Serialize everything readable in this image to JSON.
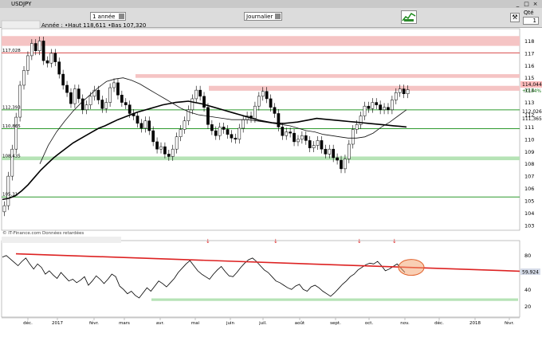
{
  "window": {
    "title": "USDJPY"
  },
  "toolbar": {
    "period": "1 année",
    "chart_type": "Journalier",
    "qty_label": "Qté",
    "qty_value": "1"
  },
  "header": {
    "legend": "Année : •Haut 118,611 •Bas 107,320"
  },
  "source_note": "© IT-Finance.com Données retardées",
  "colors": {
    "candle": "#000000",
    "ma_long": "#000000",
    "resistance_zone": "#f5c4c4",
    "resistance_line": "#d94c4c",
    "support_zone": "#b6e3b6",
    "support_line": "#2e9a2e",
    "trendline": "#dd2222",
    "highlight": "#f3a06a",
    "price_badge": "#ffbcbc",
    "rsi_badge": "#d5dbe8"
  },
  "chart_data": [
    {
      "type": "candlestick",
      "title": "USDJPY",
      "y_ticks": [
        "118",
        "117",
        "116",
        "115",
        "114",
        "113",
        "112",
        "111",
        "110",
        "109",
        "108",
        "107",
        "106",
        "105",
        "104",
        "103"
      ],
      "x_ticks": [
        "déc.",
        "2017",
        "févr.",
        "mars",
        "avr.",
        "mai",
        "juin",
        "juil.",
        "août",
        "sept.",
        "oct.",
        "nov.",
        "déc.",
        "2018",
        "févr."
      ],
      "ylim": [
        102.6,
        119.0
      ],
      "year_high": 118.611,
      "year_low": 107.32,
      "last_price": "114,044",
      "last_change": "+0,34%",
      "price_tags": [
        "117,028",
        "112,393",
        "110,865",
        "108,435",
        "105,31"
      ],
      "right_tags": [
        "114,044",
        "+0,34%",
        "112,026",
        "111,365"
      ],
      "resistance_zones": [
        [
          117.6,
          118.4
        ],
        [
          115.0,
          115.3
        ],
        [
          113.95,
          114.35
        ]
      ],
      "resistance_lines": [
        117.03
      ],
      "support_lines": [
        112.393,
        110.865,
        105.31
      ],
      "support_zones": [
        [
          108.3,
          108.6
        ]
      ],
      "closes": [
        104.6,
        107.0,
        109.2,
        111.8,
        114.4,
        115.6,
        116.8,
        117.8,
        117.2,
        118.0,
        116.4,
        116.2,
        117.0,
        116.3,
        115.3,
        114.4,
        113.8,
        112.9,
        114.1,
        113.3,
        112.4,
        112.8,
        113.5,
        114.0,
        113.2,
        112.5,
        113.0,
        114.2,
        114.6,
        113.6,
        113.0,
        112.8,
        112.1,
        111.9,
        111.3,
        110.9,
        111.5,
        110.7,
        109.8,
        109.2,
        109.4,
        108.8,
        108.6,
        109.2,
        110.2,
        110.8,
        111.5,
        112.4,
        113.3,
        114.0,
        113.5,
        112.6,
        111.2,
        110.7,
        110.3,
        111.0,
        110.8,
        110.4,
        110.1,
        110.0,
        110.9,
        111.6,
        111.9,
        111.7,
        112.7,
        113.5,
        113.9,
        113.3,
        112.6,
        112.1,
        111.0,
        110.3,
        110.6,
        110.5,
        109.8,
        110.0,
        110.3,
        109.9,
        109.3,
        109.5,
        109.9,
        109.2,
        108.8,
        109.2,
        108.5,
        108.3,
        107.6,
        108.4,
        109.6,
        110.8,
        111.2,
        111.9,
        112.7,
        112.5,
        113.0,
        112.8,
        112.4,
        112.6,
        112.4,
        113.2,
        113.8,
        114.1,
        113.7,
        114.04
      ],
      "series": [
        {
          "name": "",
          "values": [
            105.1,
            105.2,
            105.4,
            105.8,
            106.3,
            106.9,
            107.5,
            108.0,
            108.5,
            108.9,
            109.3,
            109.7,
            110.0,
            110.3,
            110.6,
            110.9,
            111.1,
            111.35,
            111.6,
            111.8,
            112.0,
            112.2,
            112.35,
            112.5,
            112.65,
            112.8,
            112.9,
            113.0,
            113.05,
            113.1,
            113.0,
            112.9,
            112.75,
            112.6,
            112.45,
            112.3,
            112.15,
            112.0,
            111.85,
            111.7,
            111.55,
            111.45,
            111.35,
            111.3,
            111.3,
            111.35,
            111.4,
            111.5,
            111.6,
            111.7,
            111.65,
            111.6,
            111.55,
            111.5,
            111.45,
            111.4,
            111.35,
            111.3,
            111.25,
            111.2,
            111.15,
            111.1,
            111.05,
            111.0
          ]
        },
        {
          "name": "",
          "values": [
            108.0,
            109.5,
            110.6,
            111.5,
            112.3,
            113.0,
            113.6,
            114.2,
            114.7,
            114.9,
            115.0,
            114.8,
            114.5,
            114.1,
            113.7,
            113.3,
            112.9,
            112.5,
            112.2,
            112.0,
            111.9,
            111.8,
            111.7,
            111.6,
            111.6,
            111.6,
            111.5,
            111.4,
            111.3,
            111.2,
            111.1,
            110.9,
            110.7,
            110.6,
            110.4,
            110.3,
            110.2,
            110.1,
            110.1,
            110.2,
            110.5,
            111.0,
            111.4,
            111.9,
            112.4
          ]
        }
      ]
    },
    {
      "type": "line",
      "title": "",
      "y_ticks": [
        "80",
        "60",
        "40",
        "20"
      ],
      "ylim": [
        15,
        90
      ],
      "last_value": "59,924",
      "support_level": 28,
      "markers": [
        "↓",
        "↓",
        "↓",
        "↓"
      ],
      "series": [
        {
          "name": "",
          "values": [
            78,
            80,
            76,
            72,
            68,
            73,
            77,
            70,
            64,
            70,
            66,
            58,
            62,
            57,
            53,
            60,
            55,
            50,
            52,
            48,
            51,
            55,
            45,
            50,
            56,
            52,
            47,
            52,
            58,
            55,
            44,
            40,
            35,
            38,
            33,
            30,
            36,
            42,
            38,
            44,
            50,
            47,
            43,
            48,
            53,
            60,
            65,
            70,
            74,
            68,
            62,
            58,
            55,
            52,
            58,
            63,
            67,
            61,
            56,
            55,
            60,
            66,
            71,
            75,
            77,
            73,
            68,
            63,
            60,
            55,
            50,
            48,
            45,
            42,
            40,
            44,
            46,
            40,
            38,
            43,
            45,
            42,
            38,
            35,
            32,
            36,
            41,
            46,
            50,
            55,
            58,
            63,
            66,
            69,
            71,
            70,
            73,
            68,
            62,
            64,
            67,
            70,
            65,
            60
          ]
        },
        {
          "name": "",
          "values": [
            82.0,
            61.5
          ]
        }
      ]
    }
  ]
}
